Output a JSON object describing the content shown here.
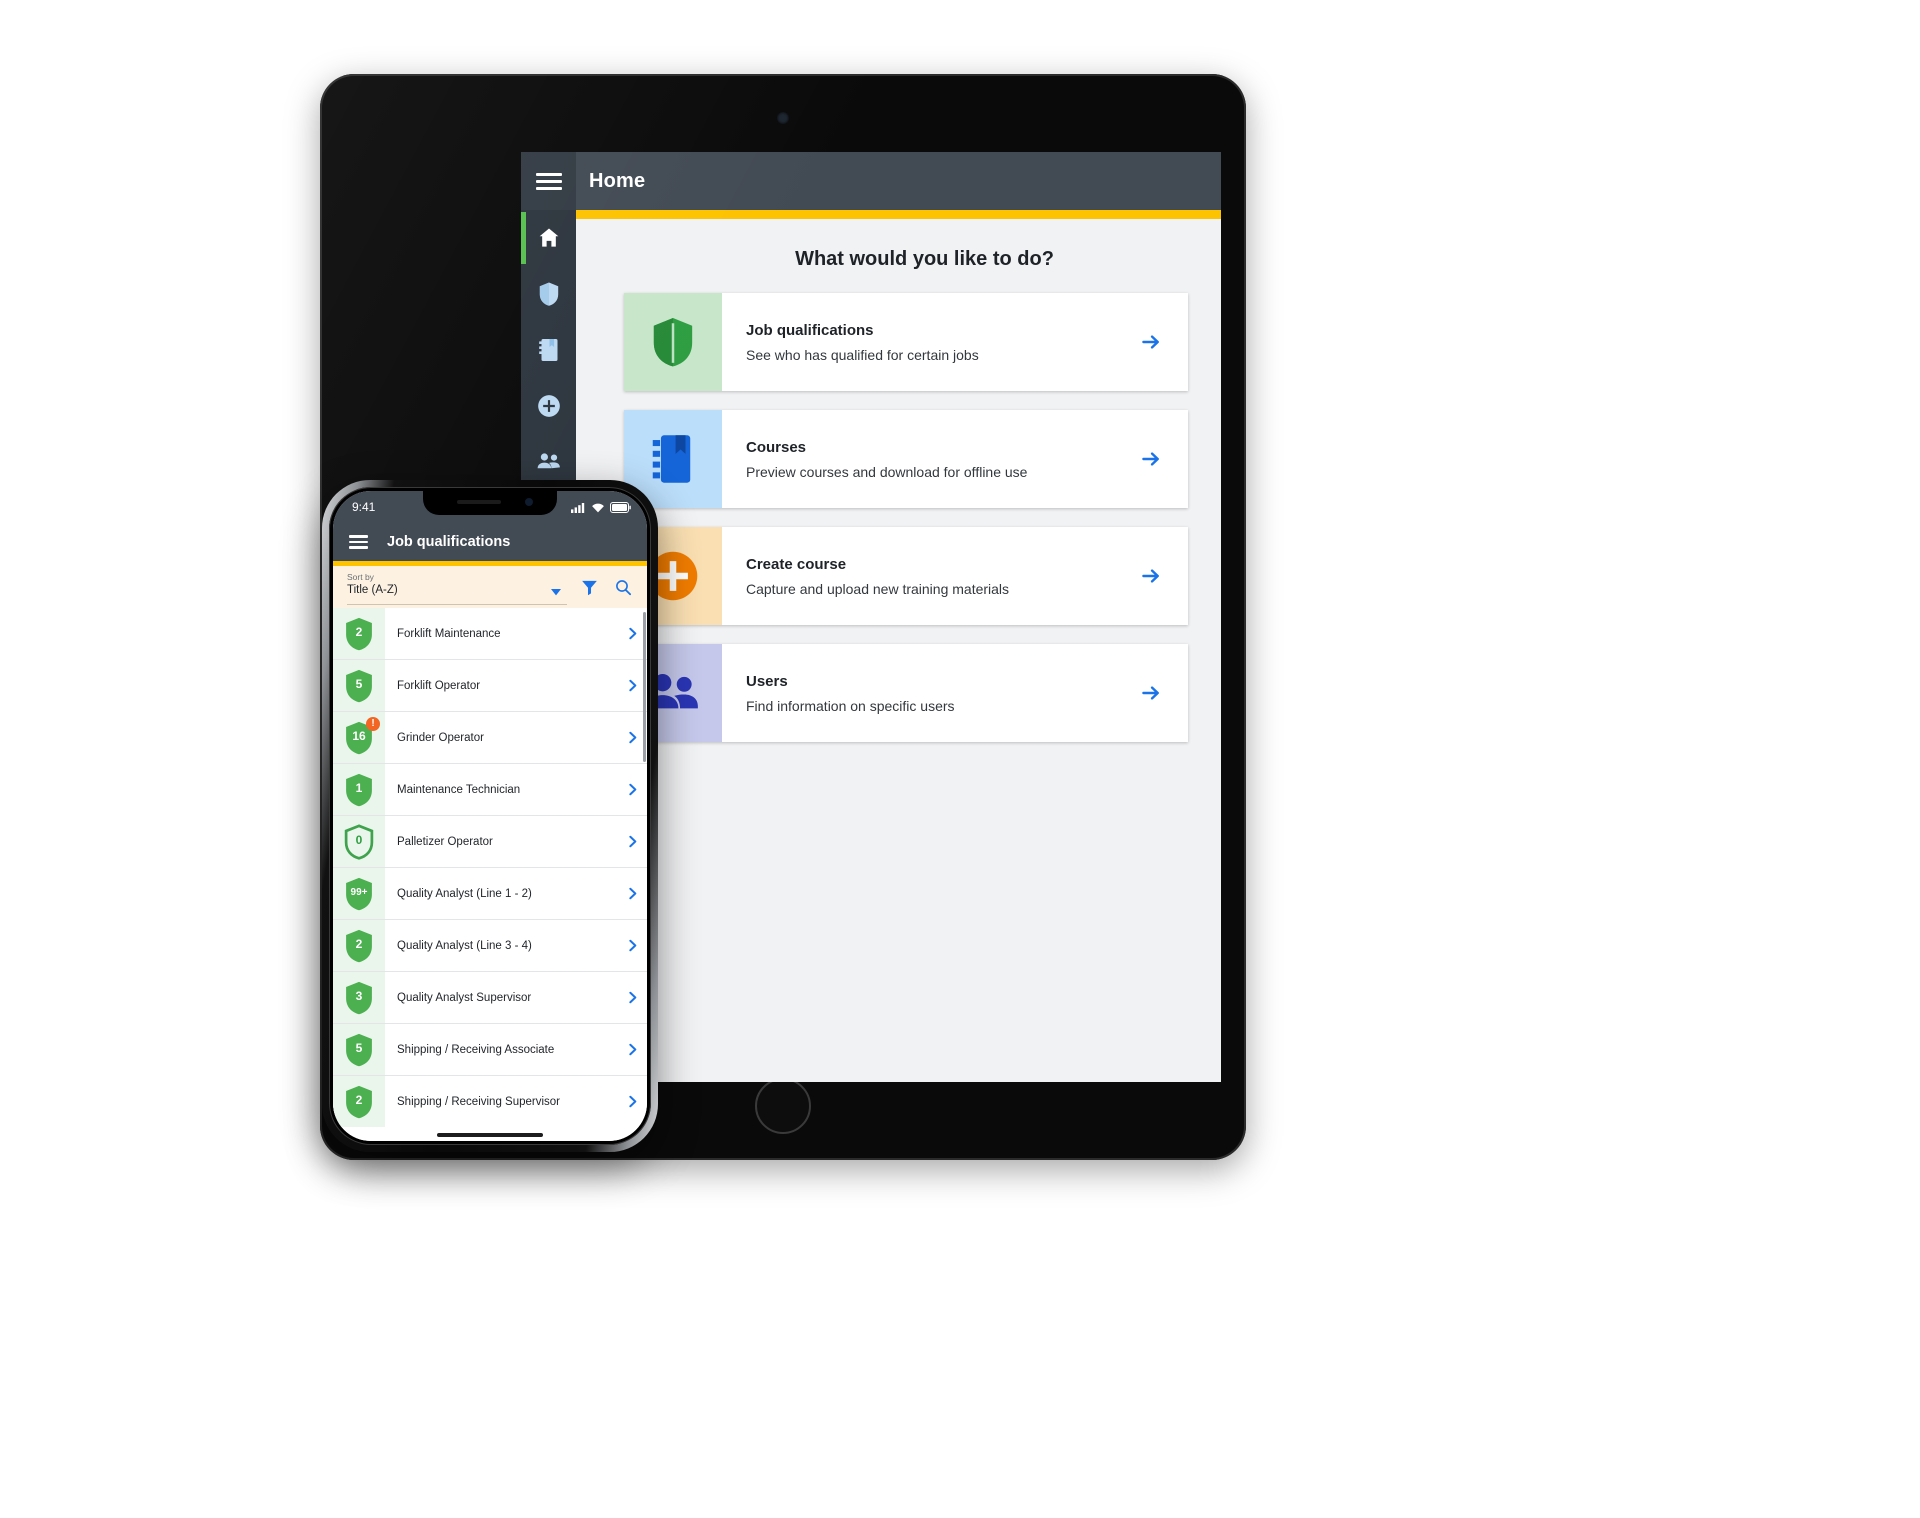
{
  "tablet": {
    "menu_icon": "hamburger-icon",
    "title": "Home",
    "accent_color": "#fdc300",
    "rail": [
      {
        "name": "home",
        "icon": "home-icon",
        "active": true
      },
      {
        "name": "job-qualifications",
        "icon": "shield-icon",
        "active": false
      },
      {
        "name": "courses",
        "icon": "book-icon",
        "active": false
      },
      {
        "name": "create-course",
        "icon": "plus-circle-icon",
        "active": false
      },
      {
        "name": "users",
        "icon": "people-icon",
        "active": false
      }
    ],
    "heading": "What would you like to do?",
    "cards": [
      {
        "title": "Job qualifications",
        "subtitle": "See who has qualified for certain jobs",
        "icon": "shield-icon",
        "icon_bg": "#c8e6c9",
        "icon_color": "#2e9e42",
        "arrow": "chevron-right-icon"
      },
      {
        "title": "Courses",
        "subtitle": "Preview courses and download for offline use",
        "icon": "book-icon",
        "icon_bg": "#bbdefb",
        "icon_color": "#1565d8",
        "arrow": "chevron-right-icon"
      },
      {
        "title": "Create course",
        "subtitle": "Capture and upload new training materials",
        "icon": "plus-circle-icon",
        "icon_bg": "#fadfb2",
        "icon_color": "#f07c00",
        "arrow": "chevron-right-icon"
      },
      {
        "title": "Users",
        "subtitle": "Find information on specific users",
        "icon": "people-icon",
        "icon_bg": "#c5c8ea",
        "icon_color": "#2a35b5",
        "arrow": "chevron-right-icon"
      }
    ]
  },
  "phone": {
    "status": {
      "time": "9:41",
      "signal": "signal-icon",
      "wifi": "wifi-icon",
      "battery": "battery-icon"
    },
    "menu_icon": "hamburger-icon",
    "title": "Job qualifications",
    "accent_color": "#fdc300",
    "sort": {
      "label": "Sort by",
      "value": "Title (A-Z)",
      "caret": "chevron-down-icon",
      "filter_icon": "filter-icon",
      "search_icon": "search-icon"
    },
    "list": [
      {
        "count": "2",
        "label": "Forklift Maintenance",
        "alert": false,
        "hollow": false
      },
      {
        "count": "5",
        "label": "Forklift Operator",
        "alert": false,
        "hollow": false
      },
      {
        "count": "16",
        "label": "Grinder Operator",
        "alert": true,
        "hollow": false
      },
      {
        "count": "1",
        "label": "Maintenance Technician",
        "alert": false,
        "hollow": false
      },
      {
        "count": "0",
        "label": "Palletizer Operator",
        "alert": false,
        "hollow": true
      },
      {
        "count": "99+",
        "label": "Quality Analyst (Line 1 - 2)",
        "alert": false,
        "hollow": false
      },
      {
        "count": "2",
        "label": "Quality Analyst (Line 3 - 4)",
        "alert": false,
        "hollow": false
      },
      {
        "count": "3",
        "label": "Quality Analyst Supervisor",
        "alert": false,
        "hollow": false
      },
      {
        "count": "5",
        "label": "Shipping / Receiving Associate",
        "alert": false,
        "hollow": false
      },
      {
        "count": "2",
        "label": "Shipping / Receiving Supervisor",
        "alert": false,
        "hollow": false
      }
    ],
    "alert_glyph": "!",
    "chevron": "chevron-right-icon"
  }
}
